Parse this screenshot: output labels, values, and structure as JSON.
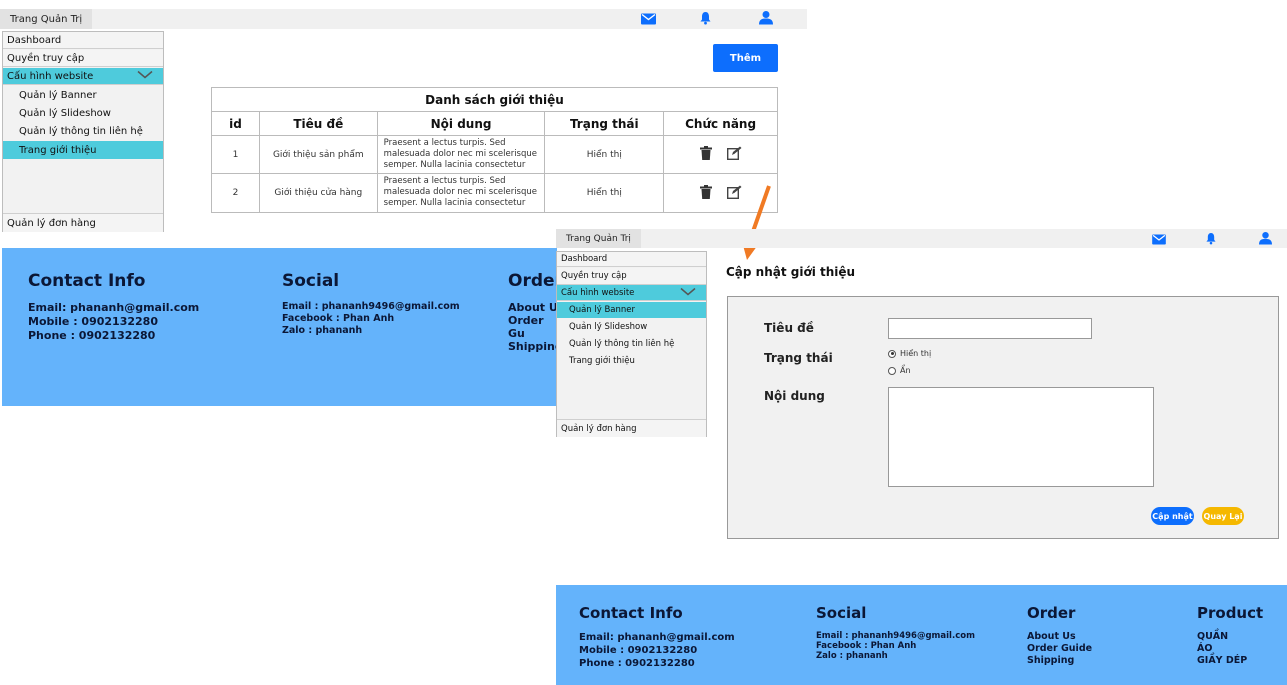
{
  "screen1": {
    "topbar": {
      "brand": "Trang Quản Trị",
      "icons": [
        "mail-icon",
        "bell-icon",
        "user-icon"
      ]
    },
    "sidebar": {
      "dashboard": "Dashboard",
      "access": "Quyền truy cập",
      "config": "Cấu hình website",
      "subitems": [
        "Quản lý Banner",
        "Quản lý Slideshow",
        "Quản lý thông tin liên hệ",
        "Trang giới thiệu"
      ],
      "orders": "Quản lý đơn hàng"
    },
    "add_button": "Thêm",
    "table": {
      "title": "Danh sách giới thiệu",
      "headers": [
        "id",
        "Tiêu đề",
        "Nội dung",
        "Trạng thái",
        "Chức năng"
      ],
      "rows": [
        {
          "id": "1",
          "title": "Giới thiệu sản phẩm",
          "content": "Praesent a lectus turpis. Sed malesuada dolor nec mi scelerisque semper. Nulla lacinia consectetur mi, non congue",
          "status": "Hiển thị"
        },
        {
          "id": "2",
          "title": "Giới thiệu cửa hàng",
          "content": "Praesent a lectus turpis. Sed malesuada dolor nec mi scelerisque semper. Nulla lacinia consectetur mi, non congue",
          "status": "Hiển thị"
        }
      ]
    },
    "footer": {
      "contact_title": "Contact Info",
      "contact_lines": [
        "Email: phananh@gmail.com",
        "Mobile : 0902132280",
        "Phone : 0902132280"
      ],
      "social_title": "Social",
      "social_lines": [
        "Email : phananh9496@gmail.com",
        "Facebook : Phan Anh",
        "Zalo : phananh"
      ],
      "order_title": "Order",
      "order_lines": [
        "About U",
        "Order Gu",
        "Shipping"
      ]
    }
  },
  "screen2": {
    "topbar": {
      "brand": "Trang Quản Trị"
    },
    "sidebar": {
      "dashboard": "Dashboard",
      "access": "Quyền truy cập",
      "config": "Cấu hình website",
      "subitems": [
        "Quản lý Banner",
        "Quản lý Slideshow",
        "Quản lý thông tin liên hệ",
        "Trang giới thiệu"
      ],
      "orders": "Quản lý đơn hàng"
    },
    "page_title": "Cập nhật giới thiệu",
    "form": {
      "title_label": "Tiêu đề",
      "status_label": "Trạng thái",
      "status_options": [
        "Hiển thị",
        "Ẩn"
      ],
      "content_label": "Nội dung",
      "update_button": "Cập nhật",
      "back_button": "Quay Lại"
    },
    "footer": {
      "contact_title": "Contact Info",
      "contact_lines": [
        "Email: phananh@gmail.com",
        "Mobile : 0902132280",
        "Phone : 0902132280"
      ],
      "social_title": "Social",
      "social_lines": [
        "Email : phananh9496@gmail.com",
        "Facebook : Phan Anh",
        "Zalo : phananh"
      ],
      "order_title": "Order",
      "order_lines": [
        "About Us",
        "Order Guide",
        "Shipping"
      ],
      "product_title": "Product",
      "product_lines": [
        "QUẦN",
        "ÁO",
        "GIẦY DÉP"
      ]
    }
  },
  "colors": {
    "accent": "#0d6efd",
    "active": "#4ecbdc",
    "footer": "#64b3fb",
    "arrow": "#f07a24",
    "back_button": "#f5b800"
  }
}
